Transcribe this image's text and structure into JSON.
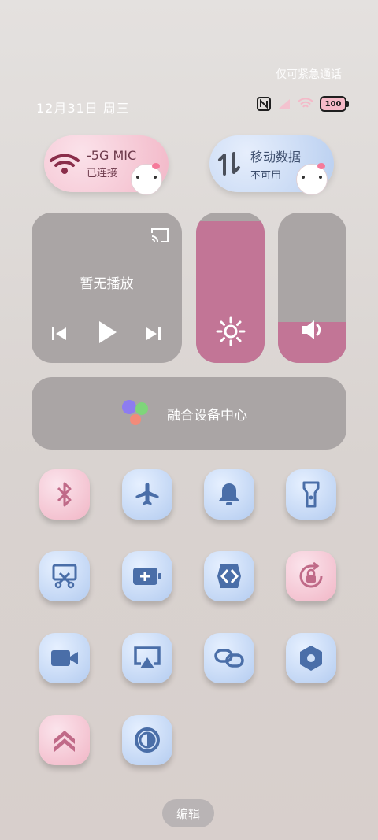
{
  "status_bar": {
    "emergency_text": "仅可紧急通话",
    "date_text": "12月31日 周三",
    "battery_level": "100",
    "icons": [
      "nfc-icon",
      "signal-icon",
      "wifi-icon",
      "battery-icon"
    ]
  },
  "wifi_card": {
    "title": "-5G   MIC",
    "subtitle": "已连接",
    "icon": "wifi-icon"
  },
  "mobile_card": {
    "title": "移动数据",
    "subtitle": "不可用",
    "icon": "mobile-data-icon"
  },
  "media": {
    "empty_text": "暂无播放",
    "icons": [
      "cast-icon",
      "previous-icon",
      "play-icon",
      "next-icon"
    ]
  },
  "brightness": {
    "level_percent": 94,
    "icon": "sun-icon"
  },
  "volume": {
    "level_percent": 27,
    "icon": "speaker-icon"
  },
  "fusion": {
    "label": "融合设备中心"
  },
  "toggles": [
    {
      "name": "bluetooth",
      "icon": "bluetooth-icon",
      "theme": "pink"
    },
    {
      "name": "airplane",
      "icon": "airplane-icon",
      "theme": "blue"
    },
    {
      "name": "ring-mode",
      "icon": "bell-icon",
      "theme": "blue"
    },
    {
      "name": "flashlight",
      "icon": "flashlight-icon",
      "theme": "blue"
    },
    {
      "name": "screenshot",
      "icon": "screenshot-scissors-icon",
      "theme": "blue"
    },
    {
      "name": "battery-saver",
      "icon": "battery-saver-icon",
      "theme": "blue"
    },
    {
      "name": "nearby-share",
      "icon": "share-arrow-icon",
      "theme": "blue"
    },
    {
      "name": "rotation-lock",
      "icon": "rotation-lock-icon",
      "theme": "pink"
    },
    {
      "name": "screen-record",
      "icon": "video-camera-icon",
      "theme": "blue"
    },
    {
      "name": "screen-cast",
      "icon": "cast-screen-icon",
      "theme": "blue"
    },
    {
      "name": "link",
      "icon": "link-icon",
      "theme": "blue"
    },
    {
      "name": "nfc-hex",
      "icon": "hexagon-icon",
      "theme": "blue"
    },
    {
      "name": "performance",
      "icon": "double-chevron-up-icon",
      "theme": "pink"
    },
    {
      "name": "dark-mode",
      "icon": "contrast-icon",
      "theme": "blue"
    }
  ],
  "edit_label": "编辑",
  "colors": {
    "tile_icon_blue": "#4a6ea8",
    "tile_icon_pink": "#c06a88",
    "slider_fill": "#c27596",
    "panel_gray": "#aaa5a5"
  }
}
